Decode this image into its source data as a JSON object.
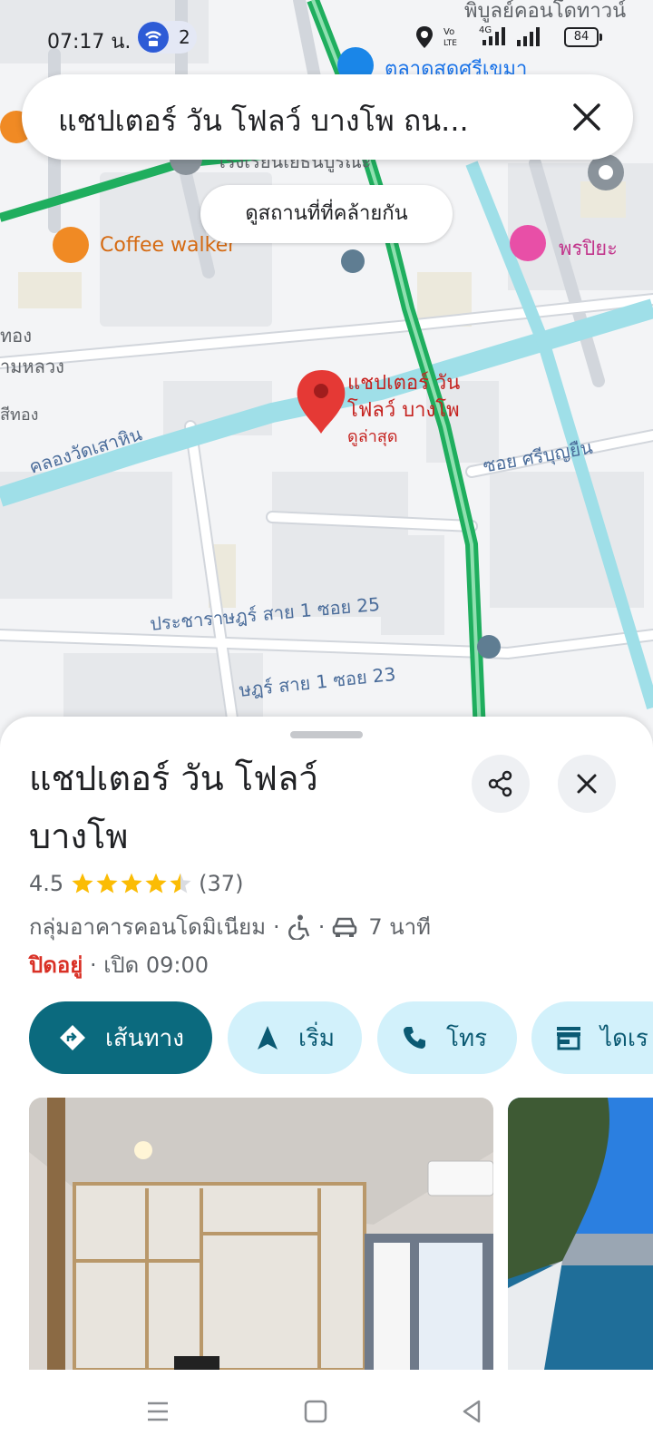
{
  "status_bar": {
    "time": "07:17 น.",
    "hotspot_count": "2",
    "battery": "84",
    "icons": [
      "wifi-hotspot-icon",
      "location-icon",
      "volte-icon",
      "4g-signal-icon",
      "signal-icon",
      "battery-icon"
    ]
  },
  "search": {
    "query": "แชปเตอร์ วัน โฟลว์ บางโพ ถน..."
  },
  "similar_places_chip": "ดูสถานที่ที่คล้ายกัน",
  "map": {
    "labels": {
      "top_right_partial": "พิบูลย์คอนโดทาวน์",
      "market": "ตลาดสดศรีเขมา",
      "school": "โรงเรียนเยธินบูรณะ",
      "cafe": "Coffee walker",
      "hotel": "พรปิยะ",
      "left_1": "ทอง",
      "left_2": "ามหลวง",
      "left_3": "สีทอง",
      "canal": "คลองวัดเสาหิน",
      "soi_sriboon": "ซอย ศรีบุญยืน",
      "road_25": "ประชาราษฎร์ สาย 1 ซอย 25",
      "road_23": "ษฎร์ สาย 1 ซอย 23",
      "pin_title_line1": "แชปเตอร์ วัน",
      "pin_title_line2": "โฟลว์ บางโพ",
      "pin_subtitle": "ดูล่าสุด"
    },
    "colors": {
      "main_road": "#1fae5e",
      "canal": "#9fdfe8",
      "pin": "#e53935"
    }
  },
  "place": {
    "name": "แชปเตอร์ วัน โฟลว์ บางโพ",
    "rating": "4.5",
    "rating_value": 4.5,
    "review_count": "(37)",
    "category": "กลุ่มอาคารคอนโดมิเนียม",
    "separator": "·",
    "drive_time": "7 นาที",
    "status": "ปิดอยู่",
    "hours": "· เปิด 09:00"
  },
  "actions": {
    "directions": "เส้นทาง",
    "start": "เริ่ม",
    "call": "โทร",
    "save_partial": "ไดเร"
  },
  "accent_color": "#0b6a7e"
}
